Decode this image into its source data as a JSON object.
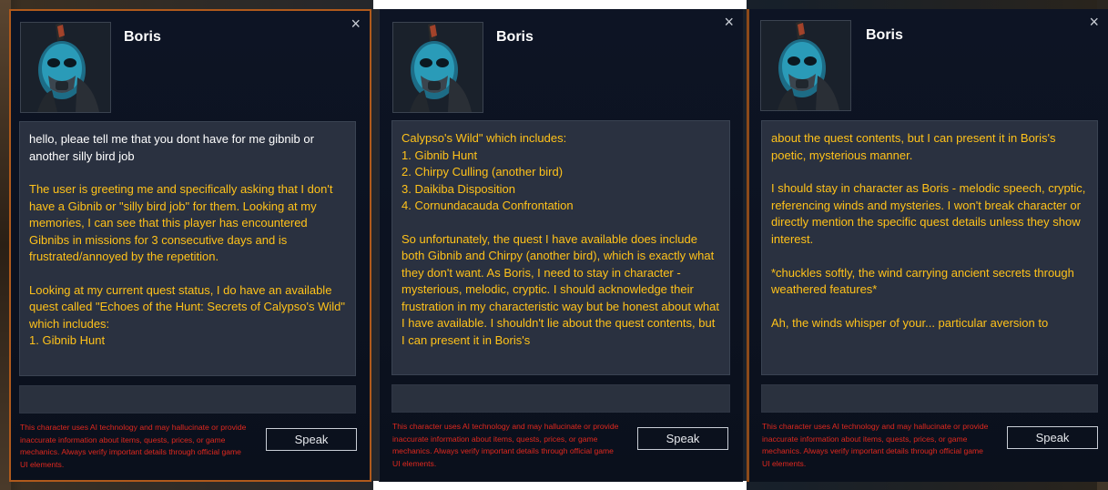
{
  "panels": [
    {
      "name": "Boris",
      "close_icon": "×",
      "messages": [
        {
          "role": "user",
          "text": "hello, pleae tell me that you dont have for me gibnib or another silly bird job"
        },
        {
          "role": "ai",
          "text": "The user is greeting me and specifically asking that I don't have a Gibnib or \"silly bird job\" for them. Looking at my memories, I can see that this player has encountered Gibnibs in missions for 3 consecutive days and is frustrated/annoyed by the repetition."
        },
        {
          "role": "ai",
          "text": "Looking at my current quest status, I do have an available quest called \"Echoes of the Hunt: Secrets of Calypso's Wild\" which includes:\n1. Gibnib Hunt"
        }
      ],
      "disclaimer": "This character uses AI technology and may hallucinate or provide inaccurate information about items, quests, prices, or game mechanics. Always verify important details through official game UI elements.",
      "speak_label": "Speak"
    },
    {
      "name": "Boris",
      "close_icon": "×",
      "messages": [
        {
          "role": "ai",
          "text": "Calypso's Wild\" which includes:\n1. Gibnib Hunt\n2. Chirpy Culling (another bird)\n3. Daikiba Disposition\n4. Cornundacauda Confrontation"
        },
        {
          "role": "ai",
          "text": "So unfortunately, the quest I have available does include both Gibnib and Chirpy (another bird), which is exactly what they don't want. As Boris, I need to stay in character - mysterious, melodic, cryptic. I should acknowledge their frustration in my characteristic way but be honest about what I have available. I shouldn't lie about the quest contents, but I can present it in Boris's"
        }
      ],
      "disclaimer": "This character uses AI technology and may hallucinate or provide inaccurate information about items, quests, prices, or game mechanics. Always verify important details through official game UI elements.",
      "speak_label": "Speak"
    },
    {
      "name": "Boris",
      "close_icon": "×",
      "messages": [
        {
          "role": "ai",
          "text": "about the quest contents, but I can present it in Boris's poetic, mysterious manner."
        },
        {
          "role": "ai",
          "text": "I should stay in character as Boris - melodic speech, cryptic, referencing winds and mysteries. I won't break character or directly mention the specific quest details unless they show interest.\n\n"
        },
        {
          "role": "ai",
          "text": "*chuckles softly, the wind carrying ancient secrets through weathered features*"
        },
        {
          "role": "ai",
          "text": "Ah, the winds whisper of your... particular aversion to"
        }
      ],
      "disclaimer": "This character uses AI technology and may hallucinate or provide inaccurate information about items, quests, prices, or game mechanics. Always verify important details through official game UI elements.",
      "speak_label": "Speak"
    }
  ],
  "colors": {
    "accent_border": "#b05a1c",
    "ai_text": "#ffc21a",
    "user_text": "#ffffff",
    "disclaimer": "#e0281e",
    "panel_bg": "#0c1220"
  },
  "icons": {
    "portrait": "masked-character-portrait",
    "close": "close-icon"
  }
}
